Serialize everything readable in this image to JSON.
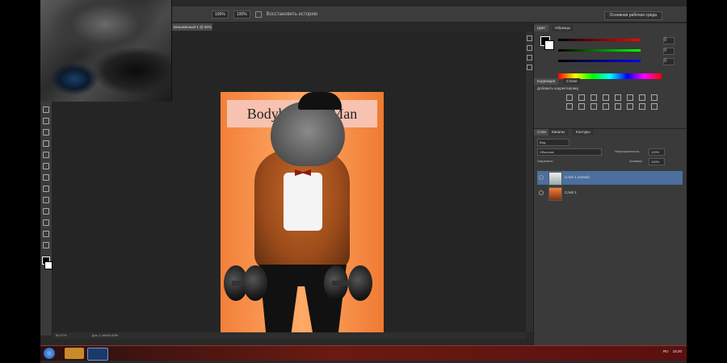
{
  "options_bar": {
    "zoom": "100%",
    "opacity": "100%",
    "airbrush_label": "Восстановить историю",
    "workspace": "Основная рабочая среда"
  },
  "document": {
    "tab_label": "Безымянный-1 @ 50% (RGB/8)",
    "banner_text": "Bodybuilding Man",
    "zoom": "50.07%",
    "doc_info": "Док: 1,48M/3,60M"
  },
  "color_panel": {
    "tab_active": "Цвет",
    "tab_other": "Образцы",
    "r": "0",
    "g": "0",
    "b": "0"
  },
  "adjustments_panel": {
    "tab_active": "Коррекция",
    "tab_other": "Стили",
    "title": "Добавить корректировку"
  },
  "layers_panel": {
    "tabs": [
      "Слои",
      "Каналы",
      "Контуры"
    ],
    "filter_kind": "Вид",
    "blend_mode": "Обычные",
    "opacity_label": "Непрозрачность:",
    "opacity_value": "100%",
    "fill_label": "Заливка:",
    "fill_value": "100%",
    "lock_label": "Закрепить:",
    "layers": [
      {
        "name": "Слой 1 (копия)",
        "selected": true
      },
      {
        "name": "Слой 1",
        "selected": false
      }
    ]
  },
  "taskbar": {
    "lang": "RU",
    "time": "15:20"
  }
}
